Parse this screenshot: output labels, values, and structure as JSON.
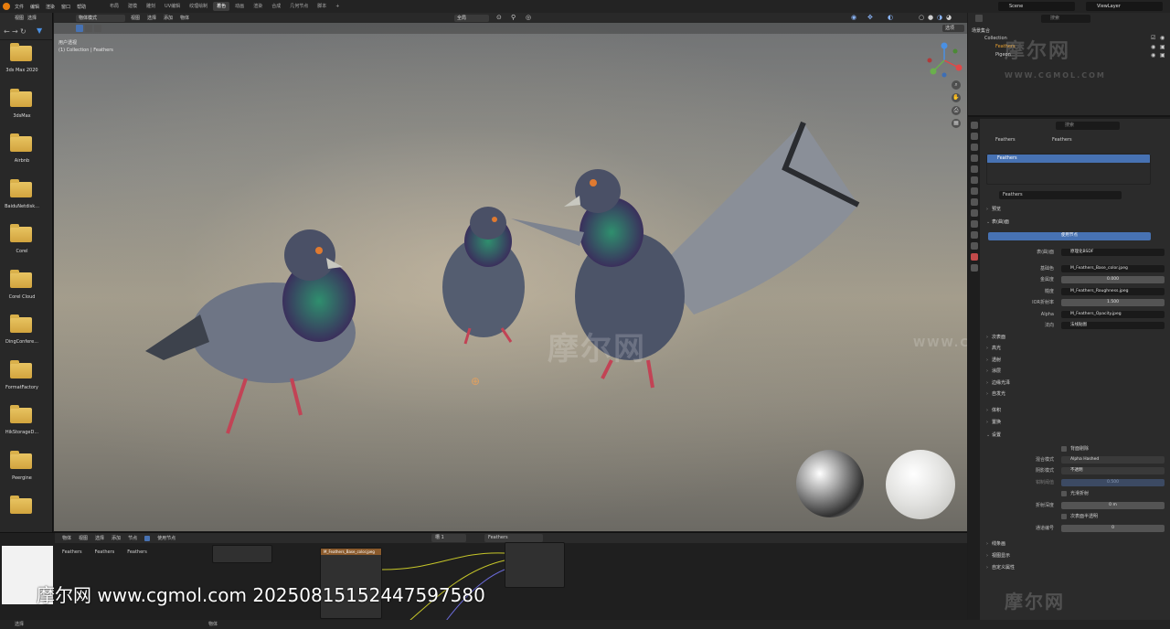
{
  "topbar": {
    "menus": [
      "文件",
      "编辑",
      "渲染",
      "窗口",
      "帮助"
    ],
    "tabs": [
      "布局",
      "建模",
      "雕刻",
      "UV编辑",
      "纹理绘制",
      "着色",
      "动画",
      "渲染",
      "合成",
      "几何节点",
      "脚本"
    ],
    "active_tab_index": 5,
    "scene": "Scene",
    "view_layer": "ViewLayer"
  },
  "file_browser": {
    "header_items": [
      "视图",
      "选择"
    ],
    "folders": [
      "3ds Max 2020",
      "3dsMax",
      "Airbnb",
      "BaiduNetdisk...",
      "Corel",
      "Corel Cloud",
      "DingConfere...",
      "FormatFactory",
      "HikStorageD...",
      "Peergine",
      ""
    ]
  },
  "viewport": {
    "mode": "物体模式",
    "menus": [
      "视图",
      "选择",
      "添加",
      "物体"
    ],
    "transform_orientation": "全局",
    "info_line1": "用户透视",
    "info_line2": "(1) Collection | Feathers",
    "options_label": "选项"
  },
  "outliner": {
    "title": "场景集合",
    "items": [
      {
        "label": "Collection"
      },
      {
        "label": "Feathers"
      },
      {
        "label": "Pigeon"
      }
    ]
  },
  "properties": {
    "search_placeholder": "搜索",
    "breadcrumb_object": "Feathers",
    "breadcrumb_material": "Feathers",
    "slot_name": "Feathers",
    "material_name": "Feathers",
    "sections": {
      "preview": "预览",
      "surface": "表(曲)面",
      "use_nodes": "使用节点",
      "surface_label": "表(曲)面",
      "surface_value": "原理化BSDF",
      "base_color_label": "基础色",
      "base_color_value": "M_Feathers_Base_color.jpeg",
      "metallic_label": "金属度",
      "metallic_value": "0.000",
      "roughness_label": "糙度",
      "roughness_value": "M_Feathers_Roughness.jpeg",
      "ior_label": "IOR折射率",
      "ior_value": "1.500",
      "alpha_label": "Alpha",
      "alpha_value": "M_Feathers_Opacity.jpeg",
      "normal_label": "法向",
      "normal_value": "法线贴图",
      "subsurface": "次表面",
      "specular": "高光",
      "transmission": "透射",
      "coat": "涂层",
      "sheen": "边缘光泽",
      "emission": "自发光",
      "volume": "体积",
      "displacement": "置换",
      "settings": "设置",
      "backface_culling": "背面剔除",
      "blend_mode_label": "混合模式",
      "blend_mode_value": "Alpha Hashed",
      "shadow_mode_label": "阴影模式",
      "shadow_mode_value": "不透明",
      "clip_threshold_label": "钳制阈值",
      "clip_threshold_value": "0.500",
      "screen_refraction": "光滑折射",
      "refraction_depth_label": "折射深度",
      "refraction_depth_value": "0 m",
      "subsurface_translucency": "次表面半透明",
      "pass_index_label": "通道编号",
      "pass_index_value": "0",
      "line_art": "线条画",
      "viewport_display": "视图显示",
      "custom_properties": "自定义属性"
    }
  },
  "node_editor": {
    "header": [
      "物体",
      "视图",
      "选择",
      "添加",
      "节点"
    ],
    "use_nodes": "使用节点",
    "slot": "槽 1",
    "material": "Feathers",
    "breadcrumb": [
      "Feathers",
      "Feathers",
      "Feathers"
    ],
    "node_title": "M_Feathers_Base_color.jpeg"
  },
  "statusbar": {
    "left": "选择",
    "middle": "物体"
  },
  "watermark": {
    "brand": "摩尔网",
    "domain": "WWW.CGMOL.COM",
    "caption": "摩尔网 www.cgmol.com 20250815152447597580"
  }
}
